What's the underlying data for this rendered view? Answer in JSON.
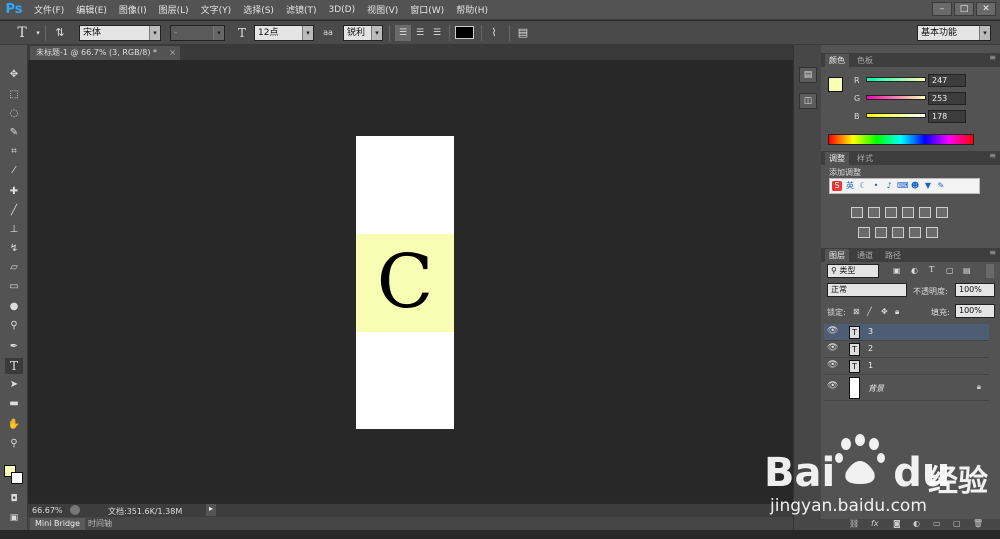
{
  "app": {
    "logo": "Ps"
  },
  "menu": [
    "文件(F)",
    "编辑(E)",
    "图像(I)",
    "图层(L)",
    "文字(Y)",
    "选择(S)",
    "滤镜(T)",
    "3D(D)",
    "视图(V)",
    "窗口(W)",
    "帮助(H)"
  ],
  "window_controls": {
    "min": "–",
    "max": "□",
    "close": "✕"
  },
  "options": {
    "font_family": "宋体",
    "font_style": "-",
    "font_size": "12点",
    "antialias_icon": "aa",
    "antialias": "锐利",
    "workspace": "基本功能",
    "text_color": "#000000"
  },
  "document": {
    "tab_title": "未标题-1 @ 66.7% (3, RGB/8) *",
    "glyph": "C",
    "band_color": "#f7fdb2"
  },
  "status": {
    "zoom": "66.67%",
    "doc_info": "文档:351.6K/1.38M"
  },
  "bottom_tabs": [
    "Mini Bridge",
    "时间轴"
  ],
  "color_panel": {
    "tabs": [
      "颜色",
      "色板"
    ],
    "foreground": "#f7fdb2",
    "channels": [
      {
        "label": "R",
        "value": "247"
      },
      {
        "label": "G",
        "value": "253"
      },
      {
        "label": "B",
        "value": "178"
      }
    ]
  },
  "adjust_panel": {
    "tabs": [
      "调整",
      "样式"
    ],
    "title": "添加调整"
  },
  "ime_bar": {
    "logo": "S",
    "lang": "英"
  },
  "layers_panel": {
    "tabs": [
      "图层",
      "通道",
      "路径"
    ],
    "filter": "类型",
    "blend_mode": "正常",
    "opacity_label": "不透明度:",
    "opacity": "100%",
    "lock_label": "锁定:",
    "fill_label": "填充:",
    "fill": "100%",
    "layers": [
      {
        "name": "3",
        "thumb": "T"
      },
      {
        "name": "2",
        "thumb": "T"
      },
      {
        "name": "1",
        "thumb": "T"
      },
      {
        "name": "背景",
        "thumb": ""
      }
    ]
  },
  "watermark": {
    "brand": "Bai",
    "brand2": "du",
    "cn": "经验",
    "url": "jingyan.baidu.com"
  }
}
